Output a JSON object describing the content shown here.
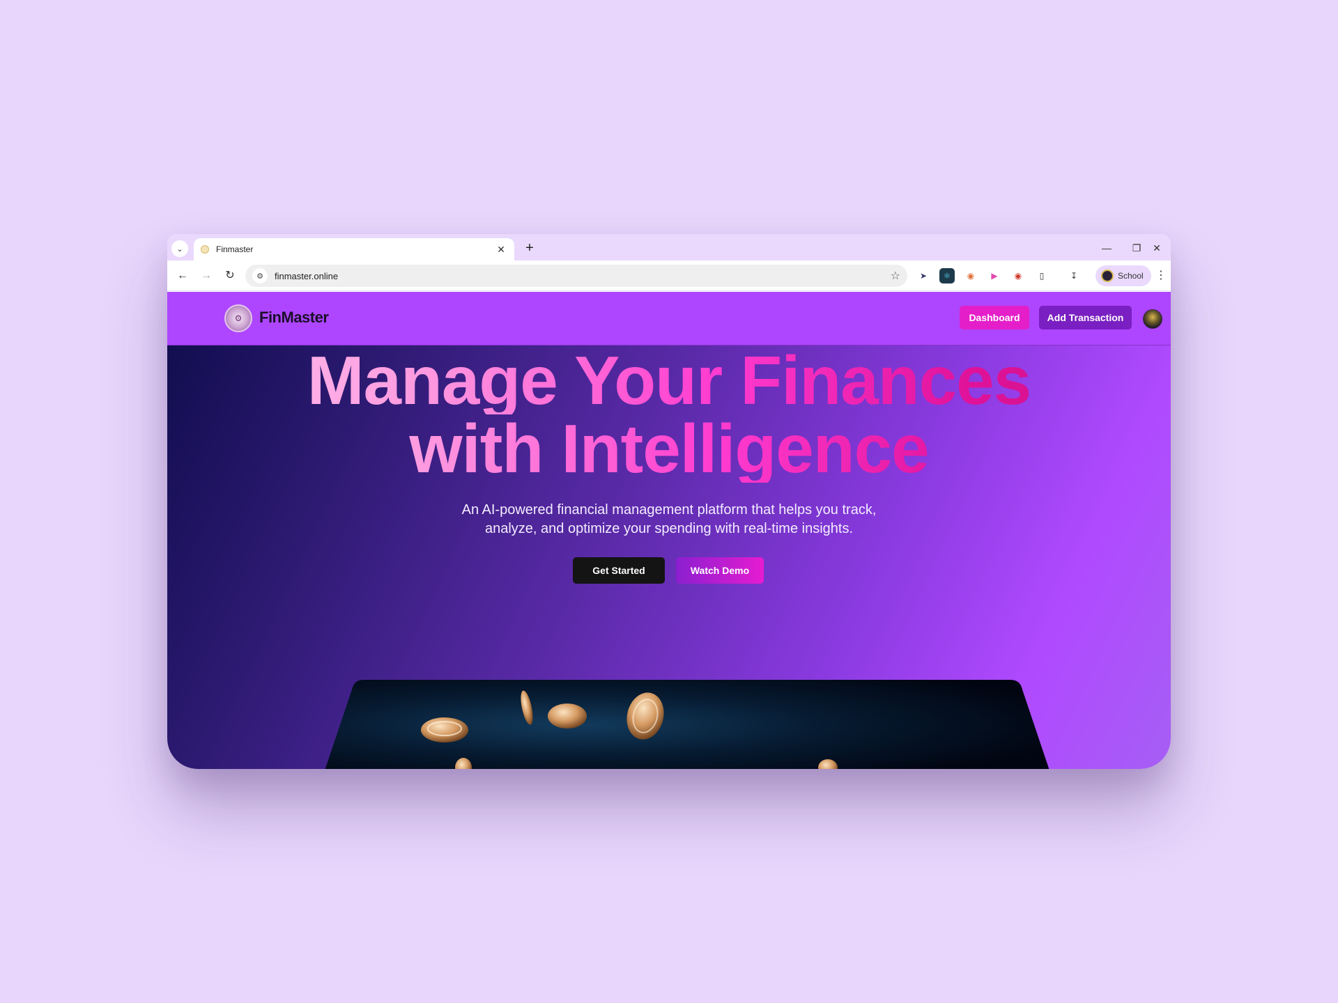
{
  "browser": {
    "tab_title": "Finmaster",
    "url": "finmaster.online",
    "profile_name": "School",
    "icons": [
      "tab-search-icon",
      "close-icon",
      "plus-icon",
      "minimize-icon",
      "restore-icon",
      "window-close-icon",
      "back-icon",
      "forward-icon",
      "reload-icon",
      "site-info-icon",
      "star-icon",
      "download-icon",
      "kebab-menu-icon"
    ]
  },
  "header": {
    "logo_text": "FinMaster",
    "dashboard_label": "Dashboard",
    "add_transaction_label": "Add Transaction"
  },
  "hero": {
    "title_line1": "Manage Your Finances",
    "title_line2": "with Intelligence",
    "subtitle_line1": "An AI-powered financial management platform that helps you track,",
    "subtitle_line2": "analyze, and optimize your spending with real-time insights.",
    "primary_cta": "Get Started",
    "secondary_cta": "Watch Demo"
  },
  "colors": {
    "background": "#e8d6fc",
    "header_bg": "#ae46ff",
    "dashboard_btn": "#e41fc9",
    "add_btn": "#7a1fc2",
    "accent_pink": "#ff3bd0"
  }
}
